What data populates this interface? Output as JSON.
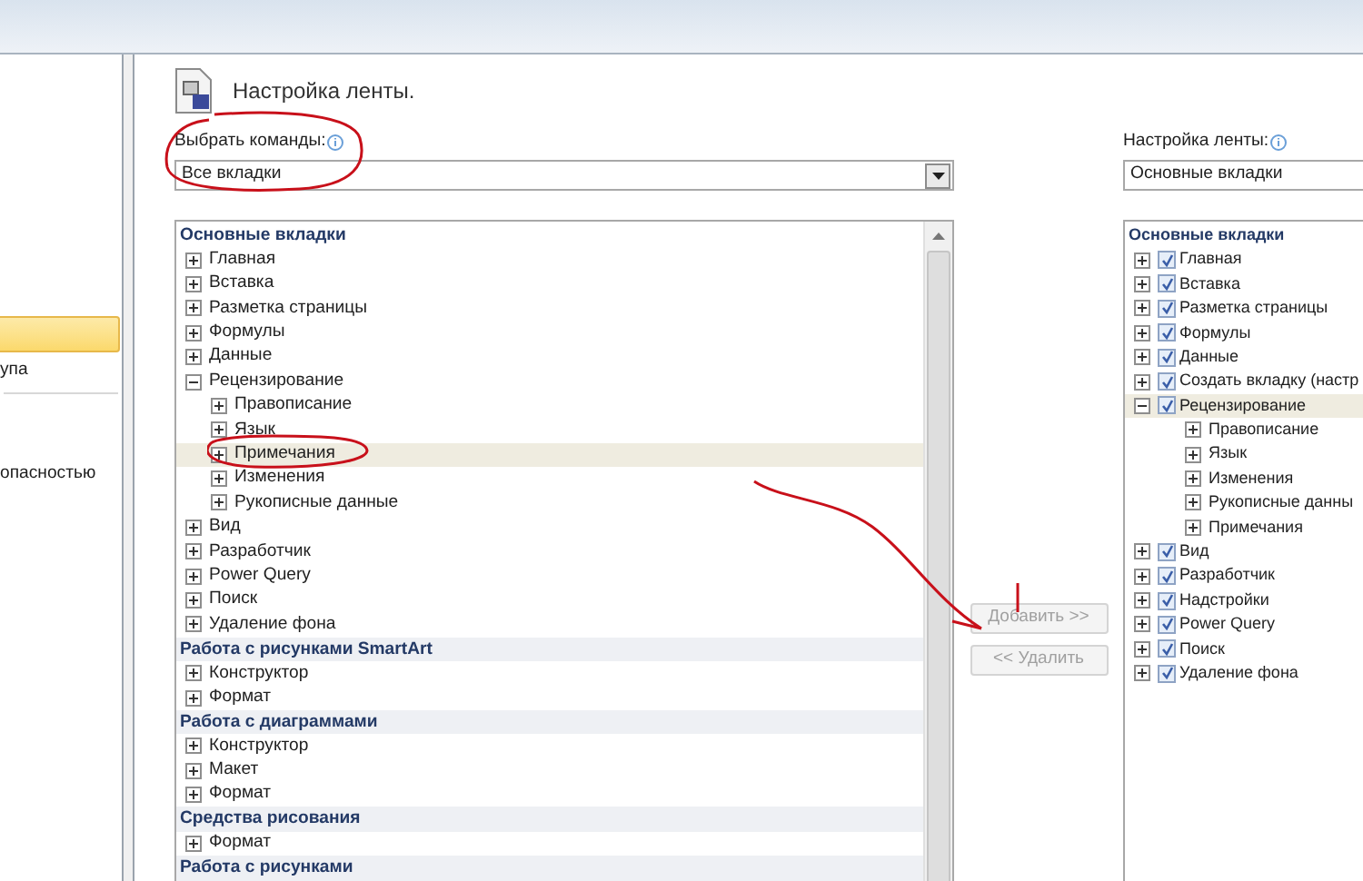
{
  "sidebar": {
    "items": [
      {
        "selected": true
      },
      {
        "label": "упа",
        "selected": false
      },
      {
        "label": "опасностью",
        "selected": false
      }
    ]
  },
  "header": {
    "title": "Настройка ленты."
  },
  "commands": {
    "label": "Выбрать команды:",
    "value": "Все вкладки",
    "tree": [
      {
        "kind": "group",
        "label": "Основные вкладки"
      },
      {
        "kind": "node",
        "label": "Главная",
        "expanded": false,
        "selected": false
      },
      {
        "kind": "node",
        "label": "Вставка",
        "expanded": false,
        "selected": false
      },
      {
        "kind": "node",
        "label": "Разметка страницы",
        "expanded": false,
        "selected": false
      },
      {
        "kind": "node",
        "label": "Формулы",
        "expanded": false,
        "selected": false
      },
      {
        "kind": "node",
        "label": "Данные",
        "expanded": false,
        "selected": false
      },
      {
        "kind": "node",
        "label": "Рецензирование",
        "expanded": true,
        "selected": false,
        "children": [
          {
            "kind": "node",
            "label": "Правописание",
            "expanded": false,
            "selected": false
          },
          {
            "kind": "node",
            "label": "Язык",
            "expanded": false,
            "selected": false
          },
          {
            "kind": "node",
            "label": "Примечания",
            "expanded": false,
            "selected": true
          },
          {
            "kind": "node",
            "label": "Изменения",
            "expanded": false,
            "selected": false
          },
          {
            "kind": "node",
            "label": "Рукописные данные",
            "expanded": false,
            "selected": false
          }
        ]
      },
      {
        "kind": "node",
        "label": "Вид",
        "expanded": false,
        "selected": false
      },
      {
        "kind": "node",
        "label": "Разработчик",
        "expanded": false,
        "selected": false
      },
      {
        "kind": "node",
        "label": "Power Query",
        "expanded": false,
        "selected": false
      },
      {
        "kind": "node",
        "label": "Поиск",
        "expanded": false,
        "selected": false
      },
      {
        "kind": "node",
        "label": "Удаление фона",
        "expanded": false,
        "selected": false
      },
      {
        "kind": "group",
        "label": "Работа с рисунками SmartArt"
      },
      {
        "kind": "node",
        "label": "Конструктор",
        "expanded": false,
        "selected": false
      },
      {
        "kind": "node",
        "label": "Формат",
        "expanded": false,
        "selected": false
      },
      {
        "kind": "group",
        "label": "Работа с диаграммами"
      },
      {
        "kind": "node",
        "label": "Конструктор",
        "expanded": false,
        "selected": false
      },
      {
        "kind": "node",
        "label": "Макет",
        "expanded": false,
        "selected": false
      },
      {
        "kind": "node",
        "label": "Формат",
        "expanded": false,
        "selected": false
      },
      {
        "kind": "group",
        "label": "Средства рисования"
      },
      {
        "kind": "node",
        "label": "Формат",
        "expanded": false,
        "selected": false
      },
      {
        "kind": "group",
        "label": "Работа с рисунками"
      }
    ]
  },
  "buttons": [
    {
      "label": "Добавить >>",
      "disabled": true
    },
    {
      "label": "<< Удалить",
      "disabled": true
    }
  ],
  "ribbon": {
    "label": "Настройка ленты:",
    "value": "Основные вкладки",
    "tree": [
      {
        "kind": "group",
        "label": "Основные вкладки"
      },
      {
        "kind": "node",
        "label": "Главная",
        "expanded": false,
        "checked": true,
        "selected": false
      },
      {
        "kind": "node",
        "label": "Вставка",
        "expanded": false,
        "checked": true,
        "selected": false
      },
      {
        "kind": "node",
        "label": "Разметка страницы",
        "expanded": false,
        "checked": true,
        "selected": false
      },
      {
        "kind": "node",
        "label": "Формулы",
        "expanded": false,
        "checked": true,
        "selected": false
      },
      {
        "kind": "node",
        "label": "Данные",
        "expanded": false,
        "checked": true,
        "selected": false
      },
      {
        "kind": "node",
        "label": "Создать вкладку (настр",
        "expanded": false,
        "checked": true,
        "selected": false
      },
      {
        "kind": "node",
        "label": "Рецензирование",
        "expanded": true,
        "checked": true,
        "selected": true,
        "children": [
          {
            "kind": "node",
            "label": "Правописание",
            "expanded": false,
            "selected": false
          },
          {
            "kind": "node",
            "label": "Язык",
            "expanded": false,
            "selected": false
          },
          {
            "kind": "node",
            "label": "Изменения",
            "expanded": false,
            "selected": false
          },
          {
            "kind": "node",
            "label": "Рукописные данны",
            "expanded": false,
            "selected": false
          },
          {
            "kind": "node",
            "label": "Примечания",
            "expanded": false,
            "selected": false
          }
        ]
      },
      {
        "kind": "node",
        "label": "Вид",
        "expanded": false,
        "checked": true,
        "selected": false
      },
      {
        "kind": "node",
        "label": "Разработчик",
        "expanded": false,
        "checked": true,
        "selected": false
      },
      {
        "kind": "node",
        "label": "Надстройки",
        "expanded": false,
        "checked": true,
        "selected": false
      },
      {
        "kind": "node",
        "label": "Power Query",
        "expanded": false,
        "checked": true,
        "selected": false
      },
      {
        "kind": "node",
        "label": "Поиск",
        "expanded": false,
        "checked": true,
        "selected": false
      },
      {
        "kind": "node",
        "label": "Удаление фона",
        "expanded": false,
        "checked": true,
        "selected": false
      }
    ]
  }
}
